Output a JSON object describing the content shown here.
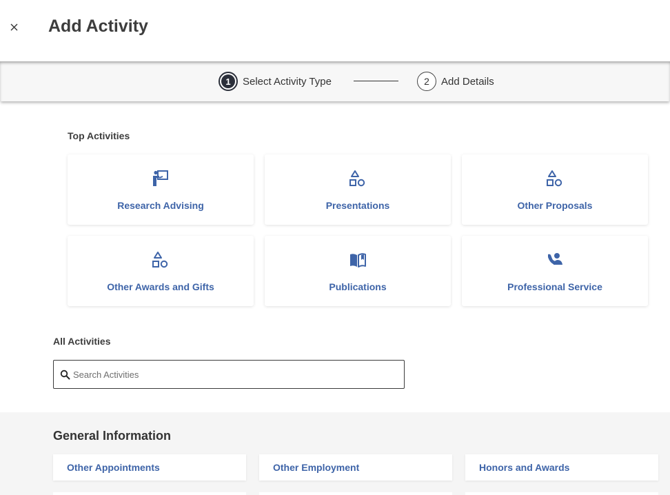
{
  "header": {
    "title": "Add Activity",
    "close_icon": "close-icon"
  },
  "stepper": {
    "steps": [
      {
        "number": "1",
        "label": "Select Activity Type",
        "state": "active"
      },
      {
        "number": "2",
        "label": "Add Details",
        "state": "inactive"
      }
    ]
  },
  "top_activities": {
    "heading": "Top Activities",
    "items": [
      {
        "label": "Research Advising",
        "icon": "teacher-board-icon"
      },
      {
        "label": "Presentations",
        "icon": "shapes-icon"
      },
      {
        "label": "Other Proposals",
        "icon": "shapes-icon"
      },
      {
        "label": "Other Awards and Gifts",
        "icon": "shapes-icon"
      },
      {
        "label": "Publications",
        "icon": "open-book-icon"
      },
      {
        "label": "Professional Service",
        "icon": "person-service-icon"
      }
    ]
  },
  "all_activities": {
    "heading": "All Activities",
    "search": {
      "placeholder": "Search Activities",
      "value": "",
      "icon": "search-icon"
    }
  },
  "general_information": {
    "heading": "General Information",
    "items": [
      {
        "label": "Other Appointments"
      },
      {
        "label": "Other Employment"
      },
      {
        "label": "Honors and Awards"
      }
    ]
  },
  "colors": {
    "accent": "#3e64a8",
    "step_active": "#2b2f3a",
    "section_bg": "#f5f5f5"
  }
}
